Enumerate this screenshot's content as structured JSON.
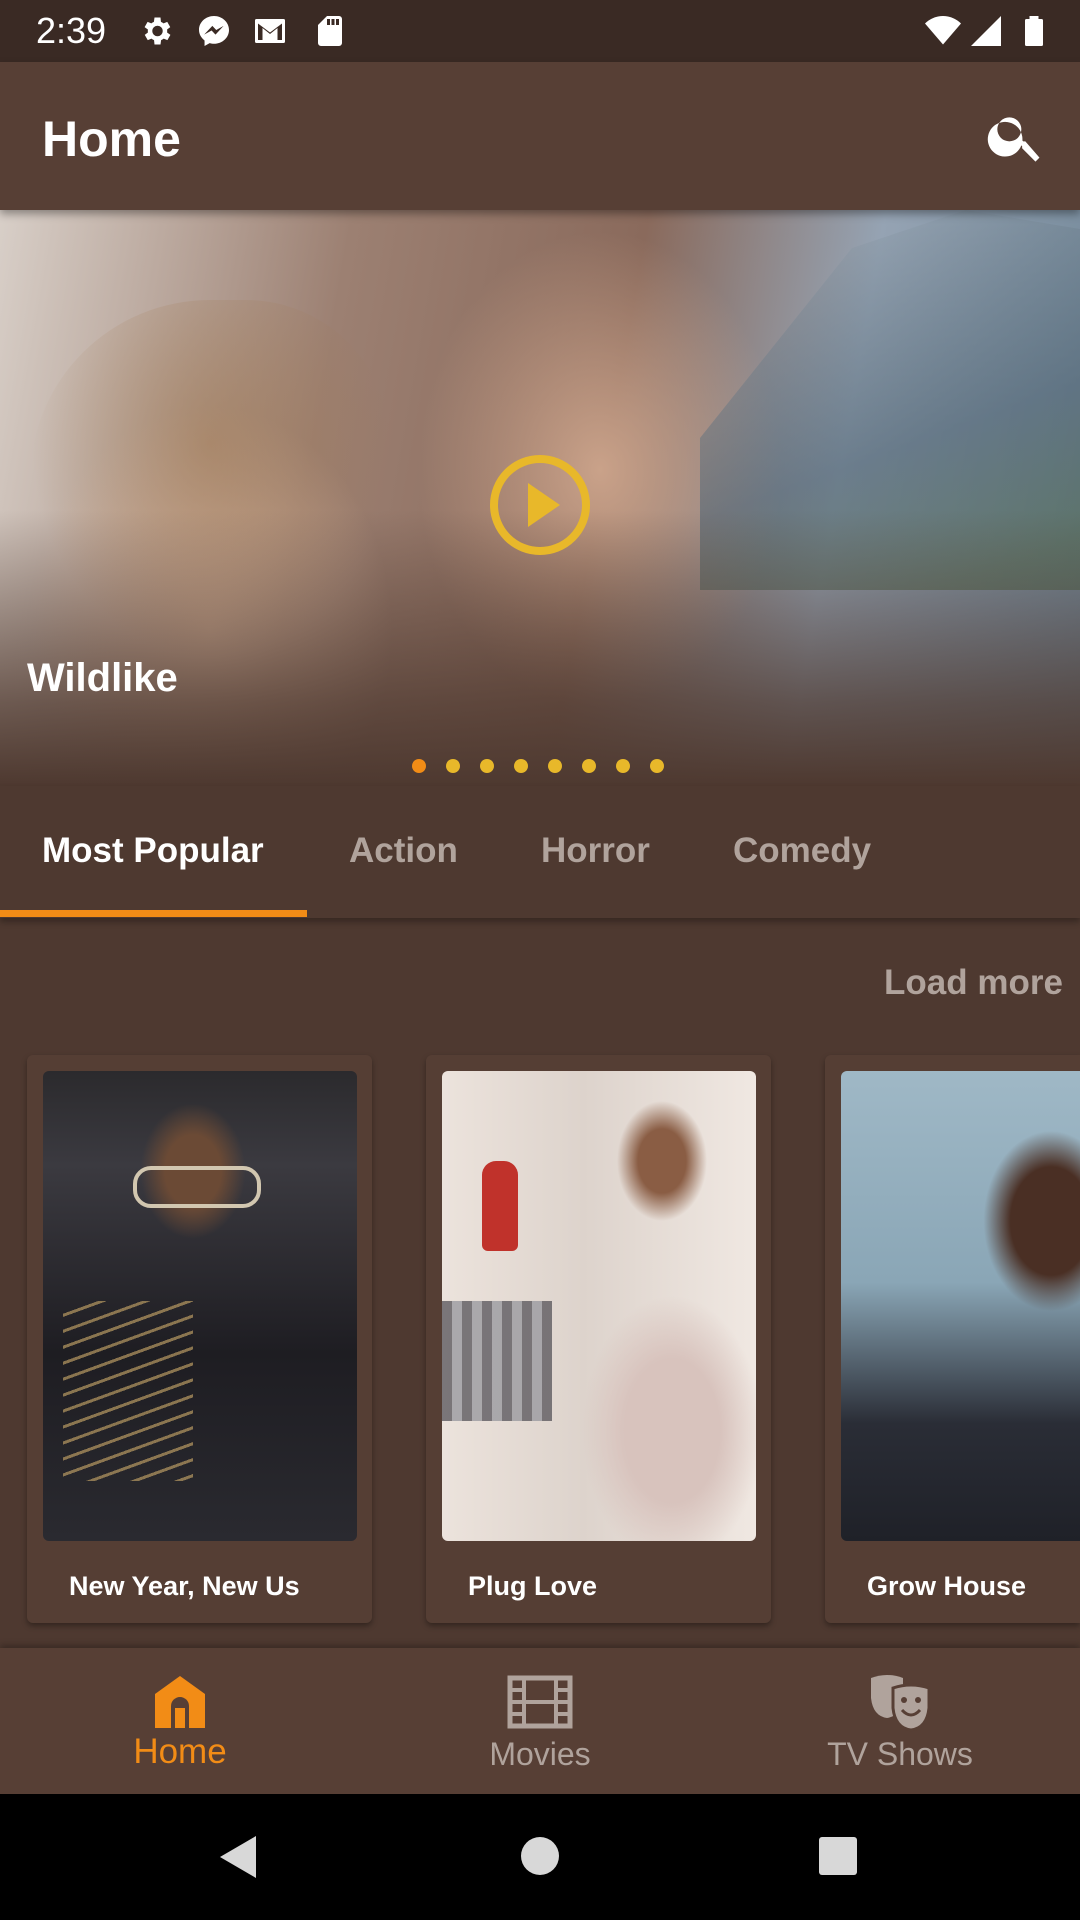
{
  "status_bar": {
    "time": "2:39",
    "icons": [
      "settings-gear-icon",
      "messenger-icon",
      "gmail-icon",
      "sd-card-icon",
      "wifi-icon",
      "signal-icon",
      "battery-icon"
    ]
  },
  "app_bar": {
    "title": "Home",
    "search_icon": "search-icon"
  },
  "hero": {
    "title": "Wildlike",
    "play_icon": "play-circle-icon",
    "carousel_pages": 8,
    "carousel_active_index": 0
  },
  "tabs": [
    {
      "label": "Most Popular",
      "active": true
    },
    {
      "label": "Action",
      "active": false
    },
    {
      "label": "Horror",
      "active": false
    },
    {
      "label": "Comedy",
      "active": false
    }
  ],
  "load_more_label": "Load more",
  "cards": [
    {
      "title": "New Year, New Us"
    },
    {
      "title": "Plug Love"
    },
    {
      "title": "Grow House"
    }
  ],
  "bottom_nav": [
    {
      "label": "Home",
      "icon": "home-icon",
      "active": true
    },
    {
      "label": "Movies",
      "icon": "film-icon",
      "active": false
    },
    {
      "label": "TV Shows",
      "icon": "theater-masks-icon",
      "active": false
    }
  ],
  "system_nav": {
    "back_icon": "back-triangle-icon",
    "home_icon": "home-circle-icon",
    "recents_icon": "recents-square-icon"
  },
  "colors": {
    "accent": "#f28c16",
    "dot": "#e8b82a",
    "background": "#4e3930",
    "app_bar": "#573f35",
    "inactive_text": "#b0a39c"
  }
}
